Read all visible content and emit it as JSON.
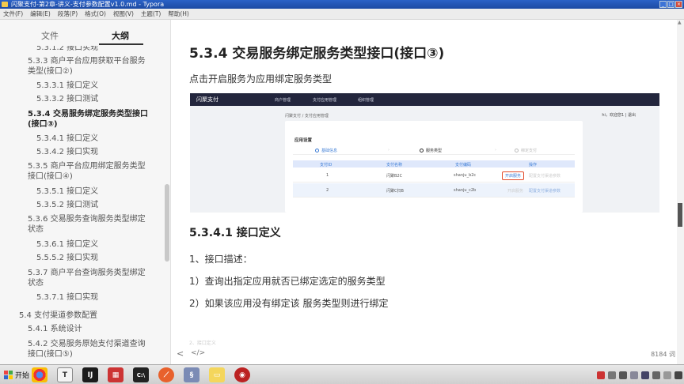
{
  "window": {
    "title": "闪聚支付-第2章-讲义-支付参数配置v1.0.md - Typora"
  },
  "menu": [
    "文件(F)",
    "编辑(E)",
    "段落(P)",
    "格式(O)",
    "视图(V)",
    "主题(T)",
    "帮助(H)"
  ],
  "sidebar": {
    "tabs": {
      "files": "文件",
      "outline": "大纲"
    },
    "items": [
      {
        "text": "5.3.1.2 接口实现"
      },
      {
        "text": "5.3.3 商户平台应用获取平台服务"
      },
      {
        "text": "类型(接口②)"
      },
      {
        "text": "5.3.3.1 接口定义"
      },
      {
        "text": "5.3.3.2 接口测试"
      },
      {
        "text": "5.3.4 交易服务绑定服务类型接口"
      },
      {
        "text": "(接口③)"
      },
      {
        "text": "5.3.4.1 接口定义"
      },
      {
        "text": "5.3.4.2 接口实现"
      },
      {
        "text": "5.3.5 商户平台应用绑定服务类型"
      },
      {
        "text": "接口(接口④)"
      },
      {
        "text": "5.3.5.1 接口定义"
      },
      {
        "text": "5.3.5.2 接口测试"
      },
      {
        "text": "5.3.6 交易服务查询服务类型绑定"
      },
      {
        "text": "状态"
      },
      {
        "text": "5.3.6.1 接口定义"
      },
      {
        "text": "5.5.5.2 接口实现"
      },
      {
        "text": "5.3.7 商户平台查询服务类型绑定"
      },
      {
        "text": "状态"
      },
      {
        "text": "5.3.7.1 接口实现"
      },
      {
        "text": "5.4 支付渠道参数配置"
      },
      {
        "text": "5.4.1 系统设计"
      },
      {
        "text": "5.4.2 交易服务原始支付渠道查询"
      },
      {
        "text": "接口(接口⑤)"
      }
    ]
  },
  "content": {
    "heading": "5.3.4 交易服务绑定服务类型接口(接口③)",
    "intro": "点击开启服务为应用绑定服务类型",
    "embed": {
      "logo": "闪聚支付",
      "nav": [
        "商户管理",
        "支付应用管理",
        "组织管理"
      ],
      "breadcrumb": "闪聚支付 / 支付应用管理",
      "user": "hi，欢迎您1  |  退出",
      "card_title": "应用设置",
      "steps": [
        "基础信息",
        "服务类型",
        "绑定支付"
      ],
      "headers": [
        "支付ID",
        "支付名称",
        "支付编码",
        "操作"
      ],
      "rows": [
        {
          "id": "1",
          "name": "闪聚B2C",
          "code": "shanju_b2c",
          "action": "开启服务",
          "link": "配置支付渠道参数"
        },
        {
          "id": "2",
          "name": "闪聚C扫B",
          "code": "shanju_c2b",
          "action": "开启服务",
          "link": "配置支付渠道参数"
        }
      ]
    },
    "subheading": "5.3.4.1 接口定义",
    "para1": "1、接口描述：",
    "para2": "1）查询出指定应用就否已绑定选定的服务类型",
    "para3": "2）如果该应用没有绑定该 服务类型则进行绑定",
    "cut_off": "2、接口定义"
  },
  "statusbar": {
    "nav_left": "<",
    "nav_source": "</>",
    "word_count": "8184 词"
  },
  "taskbar": {
    "start": "开始"
  }
}
